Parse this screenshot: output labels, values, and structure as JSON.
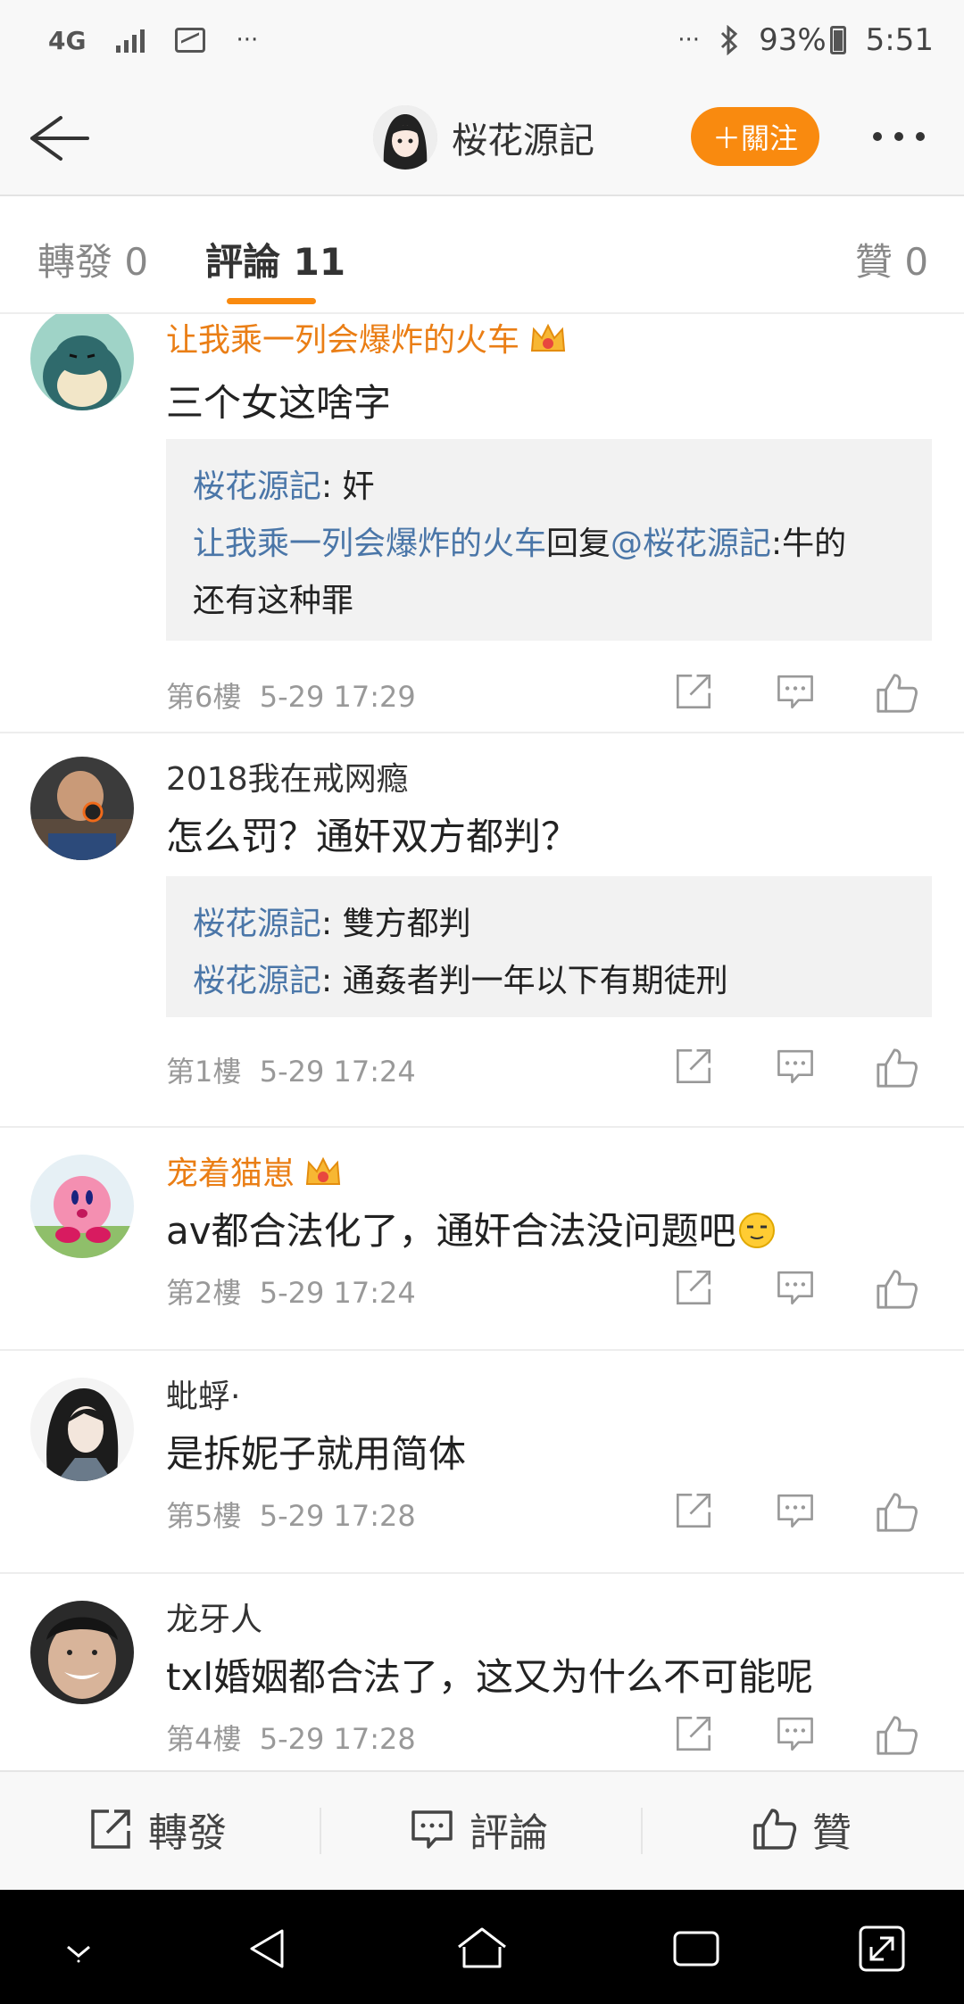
{
  "status_bar": {
    "network": "4G",
    "left_more": "···",
    "right_more": "···",
    "battery": "93%",
    "time": "5:51"
  },
  "header": {
    "title": "桜花源記",
    "follow_label": "＋關注"
  },
  "tabs": [
    {
      "label": "轉發 0"
    },
    {
      "label": "評論 11"
    },
    {
      "label": "贊 0"
    }
  ],
  "comments": [
    {
      "user": "让我乘一列会爆炸的火车",
      "vip": true,
      "text": "三个女这啥字",
      "replies": [
        {
          "name": "桜花源記",
          "sep": ": ",
          "text": "奸"
        },
        {
          "name": "让我乘一列会爆炸的火车",
          "mid": "回复",
          "mention": "@桜花源記",
          "text": ":牛的",
          "text2": "还有这种罪"
        }
      ],
      "floor": "第6樓",
      "time": "5-29 17:29"
    },
    {
      "user": "2018我在戒网瘾",
      "vip": false,
      "text": "怎么罚？通奸双方都判？",
      "replies": [
        {
          "name": "桜花源記",
          "sep": ": ",
          "text": "雙方都判"
        },
        {
          "name": "桜花源記",
          "sep": ": ",
          "text": "通姦者判一年以下有期徒刑"
        }
      ],
      "floor": "第1樓",
      "time": "5-29 17:24"
    },
    {
      "user": "宠着猫崽",
      "vip": true,
      "text": "av都合法化了，通奸合法没问题吧",
      "floor": "第2樓",
      "time": "5-29 17:24"
    },
    {
      "user": "蚍蜉·",
      "vip": false,
      "text": "是拆妮子就用简体",
      "floor": "第5樓",
      "time": "5-29 17:28"
    },
    {
      "user": "龙牙人",
      "vip": false,
      "text": "txl婚姻都合法了，这又为什么不可能呢",
      "floor": "第4樓",
      "time": "5-29 17:28"
    }
  ],
  "action_bar": {
    "repost": "轉發",
    "comment": "評論",
    "like": "贊"
  },
  "colors": {
    "accent": "#f98a0f",
    "vip_name": "#ea7e15",
    "link": "#4a76a8",
    "reply_bg": "#f2f2f2"
  },
  "icons": [
    "back-arrow-icon",
    "more-dots-icon",
    "share-icon",
    "comment-icon",
    "thumbs-up-icon",
    "crown-icon",
    "wink-emoji-icon",
    "nav-down-icon",
    "nav-back-icon",
    "nav-home-icon",
    "nav-recents-icon",
    "nav-expand-icon"
  ]
}
